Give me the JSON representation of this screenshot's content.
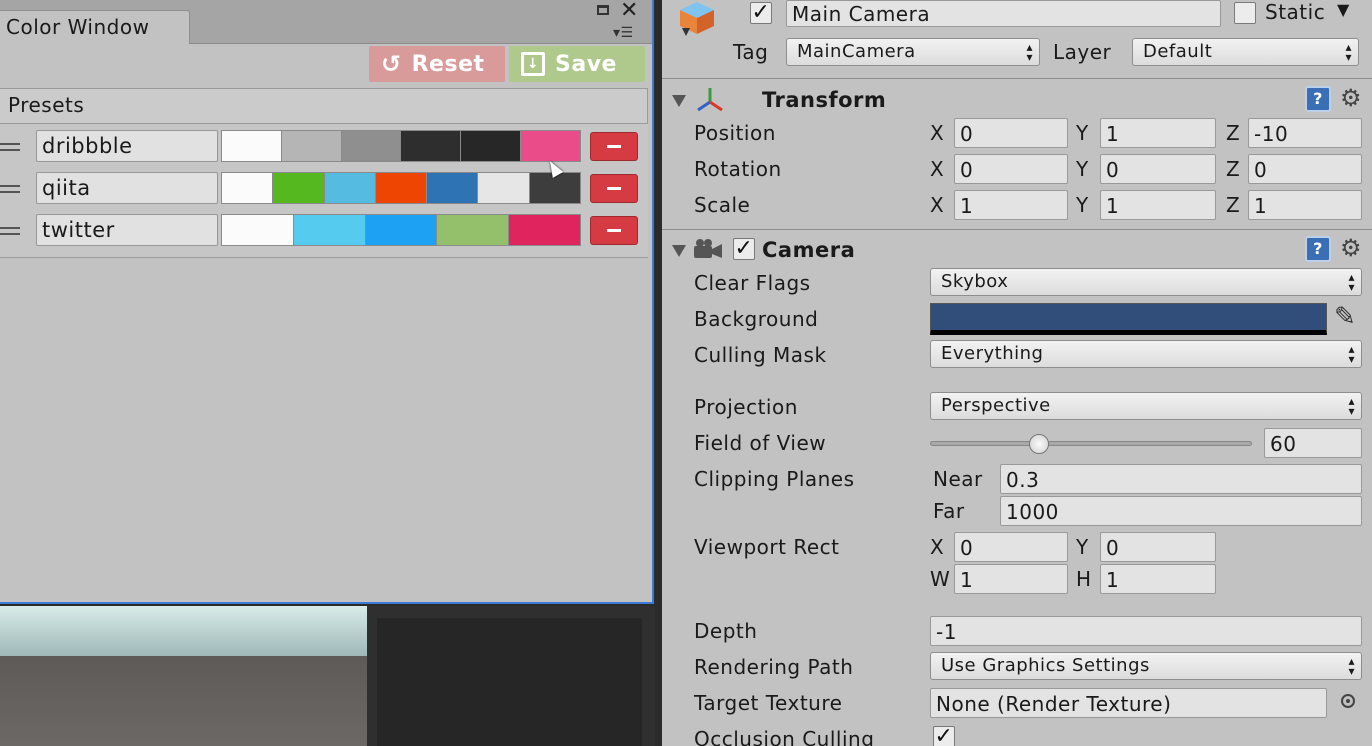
{
  "color_window": {
    "tab_title": "Color Window",
    "reset_label": "Reset",
    "save_label": "Save",
    "presets_title": "Presets",
    "presets": [
      {
        "name": "dribbble",
        "colors": [
          "#fbfbfb",
          "#b5b5b5",
          "#8f8f8f",
          "#2e2e2e",
          "#272727",
          "#ea4c89"
        ]
      },
      {
        "name": "qiita",
        "colors": [
          "#fbfbfb",
          "#55b81e",
          "#55bbe0",
          "#ee4502",
          "#2e74b5",
          "#e6e6e6",
          "#3d3d3d"
        ]
      },
      {
        "name": "twitter",
        "colors": [
          "#fbfbfb",
          "#55cbf0",
          "#1da1f2",
          "#94c06b",
          "#e0245e"
        ]
      }
    ]
  },
  "inspector": {
    "object_name": "Main Camera",
    "static_label": "Static",
    "tag_label": "Tag",
    "tag_value": "MainCamera",
    "layer_label": "Layer",
    "layer_value": "Default",
    "transform": {
      "title": "Transform",
      "position_label": "Position",
      "rotation_label": "Rotation",
      "scale_label": "Scale",
      "position": {
        "x": "0",
        "y": "1",
        "z": "-10"
      },
      "rotation": {
        "x": "0",
        "y": "0",
        "z": "0"
      },
      "scale": {
        "x": "1",
        "y": "1",
        "z": "1"
      }
    },
    "camera": {
      "title": "Camera",
      "clear_flags_label": "Clear Flags",
      "clear_flags_value": "Skybox",
      "background_label": "Background",
      "background_color": "#314d79",
      "culling_mask_label": "Culling Mask",
      "culling_mask_value": "Everything",
      "projection_label": "Projection",
      "projection_value": "Perspective",
      "fov_label": "Field of View",
      "fov_value": "60",
      "clipping_label": "Clipping Planes",
      "near_label": "Near",
      "near_value": "0.3",
      "far_label": "Far",
      "far_value": "1000",
      "viewport_label": "Viewport Rect",
      "viewport": {
        "x": "0",
        "y": "0",
        "w": "1",
        "h": "1"
      },
      "depth_label": "Depth",
      "depth_value": "-1",
      "rendering_path_label": "Rendering Path",
      "rendering_path_value": "Use Graphics Settings",
      "target_texture_label": "Target Texture",
      "target_texture_value": "None (Render Texture)",
      "occlusion_label": "Occlusion Culling"
    },
    "axes": {
      "x": "X",
      "y": "Y",
      "z": "Z",
      "w": "W",
      "h": "H"
    }
  }
}
